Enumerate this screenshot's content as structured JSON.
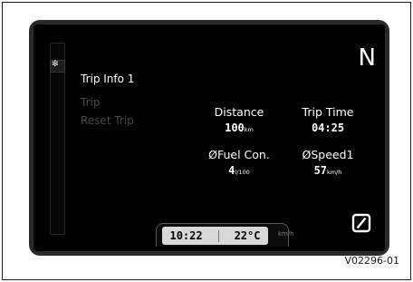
{
  "menu": {
    "active_item": "Trip Info 1",
    "items": [
      "Trip",
      "Reset Trip"
    ],
    "mode_icon_glyph": "❇"
  },
  "gear": "N",
  "trip_stats": {
    "distance": {
      "label": "Distance",
      "value": "100",
      "unit": "km"
    },
    "trip_time": {
      "label": "Trip Time",
      "value": "04:25"
    },
    "fuel_consumption": {
      "label": "ØFuel Con.",
      "value": "4",
      "unit": "l/100"
    },
    "average_speed": {
      "label": "ØSpeed1",
      "value": "57",
      "unit": "km/h"
    }
  },
  "status_bar": {
    "clock": "10:22",
    "temperature": "22°C",
    "speed_unit": "km/h"
  },
  "icons": {
    "mode": "trip-computer-icon",
    "reset": "zero-reset-icon"
  },
  "figure_code": "V02296-01"
}
